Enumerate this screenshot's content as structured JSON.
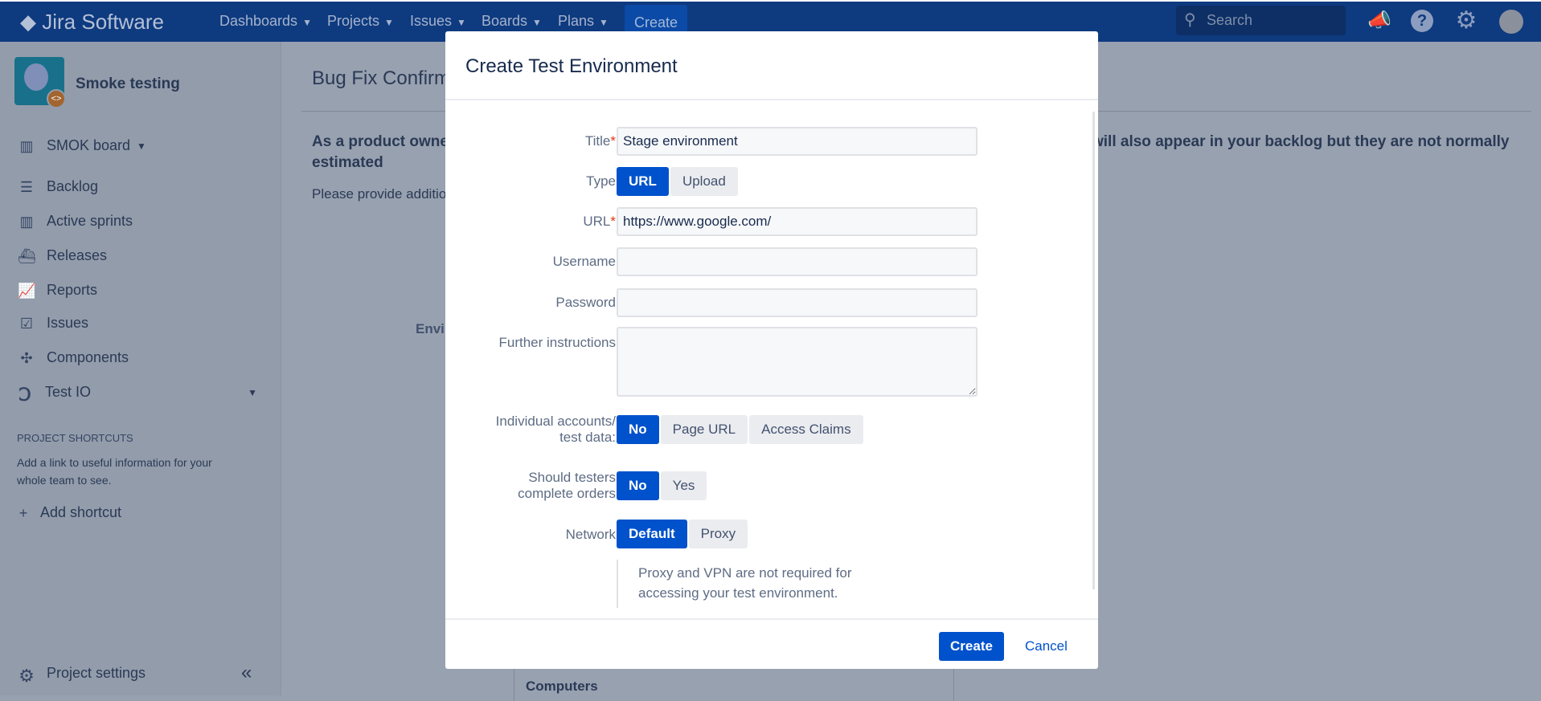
{
  "topbar": {
    "logo": "Jira Software",
    "nav": [
      "Dashboards",
      "Projects",
      "Issues",
      "Boards",
      "Plans"
    ],
    "create": "Create",
    "search_placeholder": "Search",
    "icons": [
      "megaphone-icon",
      "help-icon",
      "gear-icon",
      "avatar"
    ]
  },
  "sidebar": {
    "project_name": "Smoke testing",
    "board": "SMOK board",
    "items": [
      "Backlog",
      "Active sprints",
      "Releases",
      "Reports",
      "Issues",
      "Components"
    ],
    "test_io": "Test IO",
    "shortcuts_heading": "PROJECT SHORTCUTS",
    "shortcuts_text_1": "Add a link to useful information for your",
    "shortcuts_text_2": "whole team to see.",
    "add_shortcut": "Add shortcut",
    "project_settings": "Project settings"
  },
  "main": {
    "title": "Bug Fix Confirm",
    "para_left_1": "As a product owne",
    "para_left_2": "estimated",
    "para_right": "will also appear in your backlog but they are not normally",
    "please": "Please provide additio",
    "env_label": "Envir",
    "computers": "Computers"
  },
  "modal": {
    "title": "Create Test Environment",
    "fields": {
      "title_label": "Title",
      "title_value": "Stage environment",
      "type_label": "Type",
      "type_options": [
        "URL",
        "Upload"
      ],
      "url_label": "URL",
      "url_value": "https://www.google.com/",
      "username_label": "Username",
      "username_value": "",
      "password_label": "Password",
      "password_value": "",
      "instructions_label": "Further instructions",
      "instructions_value": "",
      "accounts_label_1": "Individual accounts/",
      "accounts_label_2": "test data:",
      "accounts_options": [
        "No",
        "Page URL",
        "Access Claims"
      ],
      "orders_label_1": "Should testers",
      "orders_label_2": "complete orders",
      "orders_options": [
        "No",
        "Yes"
      ],
      "network_label": "Network",
      "network_options": [
        "Default",
        "Proxy"
      ],
      "network_note": "Proxy and VPN are not required for accessing your test environment."
    },
    "required_mark": "*",
    "create": "Create",
    "cancel": "Cancel"
  },
  "colors": {
    "primary": "#0052cc",
    "topbar": "#0e3a7f",
    "overlay": "#98a1b0"
  }
}
